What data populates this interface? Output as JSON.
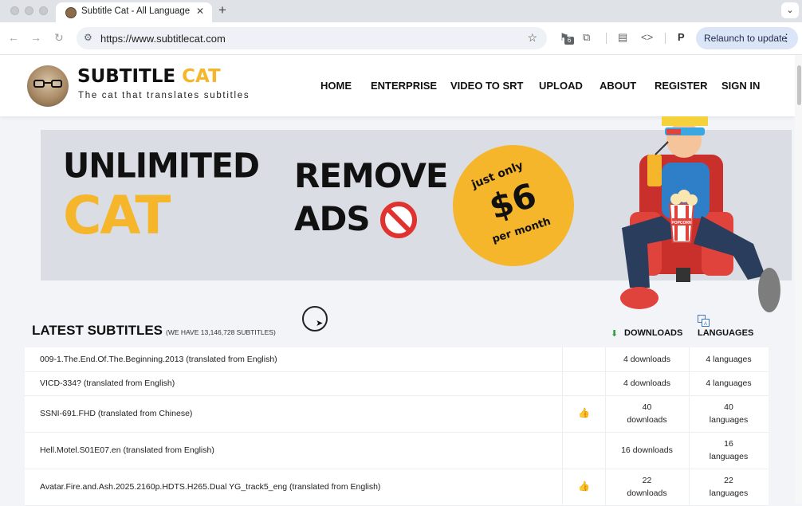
{
  "browser": {
    "tab_title": "Subtitle Cat - All Language Subtitles",
    "tab_close": "✕",
    "new_tab": "+",
    "url": "https://www.subtitlecat.com",
    "ext_badge": "6",
    "profile_letter": "P",
    "relaunch_label": "Relaunch to update",
    "menu_dots": "⋮"
  },
  "site": {
    "brand_part1": "SUBTITLE",
    "brand_part2": "CAT",
    "tagline": "The cat that translates subtitles",
    "nav": [
      "HOME",
      "ENTERPRISE",
      "VIDEO TO SRT",
      "UPLOAD",
      "ABOUT",
      "REGISTER",
      "SIGN IN"
    ]
  },
  "banner": {
    "line1": "UNLIMITED",
    "line2": "CAT",
    "remove1": "REMOVE",
    "remove2": "ADS",
    "price_top": "just only",
    "price": "$6",
    "price_bottom": "per month",
    "popcorn": "POPCORN"
  },
  "list": {
    "title": "LATEST SUBTITLES",
    "count_note": "(WE HAVE 13,146,728 SUBTITLES)",
    "col_downloads": "DOWNLOADS",
    "col_languages": "LANGUAGES",
    "rows": [
      {
        "name": "009-1.The.End.Of.The.Beginning.2013 (translated from English)",
        "thumb": "",
        "downloads": "4 downloads",
        "languages": "4 languages"
      },
      {
        "name": "VICD-334? (translated from English)",
        "thumb": "",
        "downloads": "4 downloads",
        "languages": "4 languages"
      },
      {
        "name": "SSNI-691.FHD (translated from Chinese)",
        "thumb": "👍",
        "downloads": "40 downloads",
        "languages": "40 languages"
      },
      {
        "name": "Hell.Motel.S01E07.en (translated from English)",
        "thumb": "",
        "downloads": "16 downloads",
        "languages": "16 languages"
      },
      {
        "name": "Avatar.Fire.and.Ash.2025.2160p.HDTS.H265.Dual YG_track5_eng (translated from English)",
        "thumb": "👍",
        "downloads": "22 downloads",
        "languages": "22 languages"
      }
    ]
  }
}
